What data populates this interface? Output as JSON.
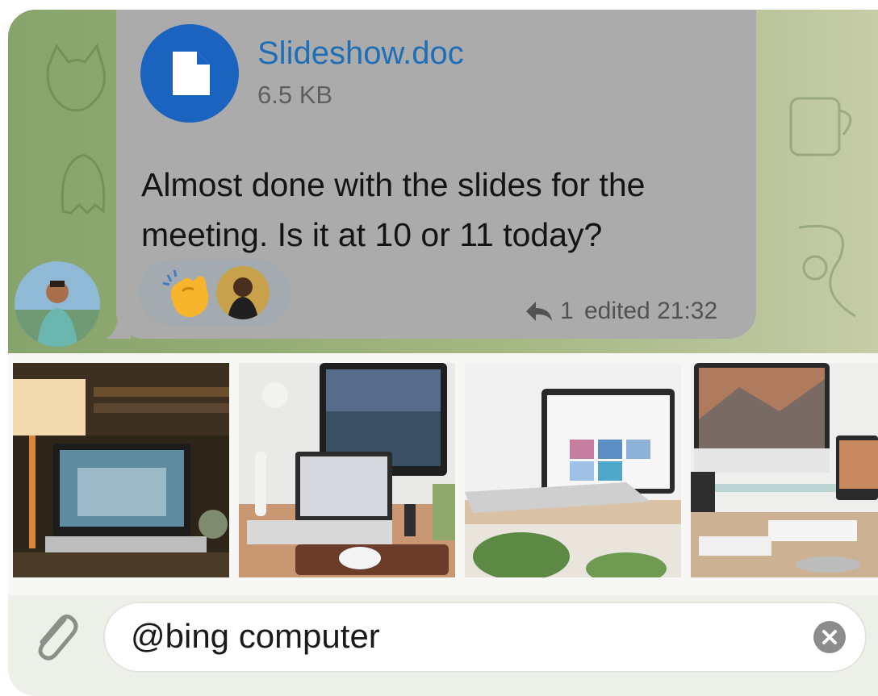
{
  "message": {
    "file_name": "Slideshow.doc",
    "file_size": "6.5 KB",
    "file_icon": "document-icon",
    "text": "Almost done with the slides for the meeting. Is it at 10 or 11 today?",
    "reactions": [
      "clapping-hands-emoji"
    ],
    "reply_count": "1",
    "edited_time": "edited 21:32"
  },
  "inline_results": [
    {
      "name": "laptop-desk-lamp-photo"
    },
    {
      "name": "imac-macbook-desk-photo"
    },
    {
      "name": "laptop-gallery-photo"
    },
    {
      "name": "imac-stand-desk-photo"
    }
  ],
  "composer": {
    "text": "@bing computer",
    "attach_icon": "paperclip-icon",
    "clear_icon": "clear-x-icon"
  },
  "colors": {
    "bubble": "#ababab",
    "file_icon": "#1a63be",
    "link": "#1e6fb8",
    "chat_bg": "#95ad74"
  }
}
